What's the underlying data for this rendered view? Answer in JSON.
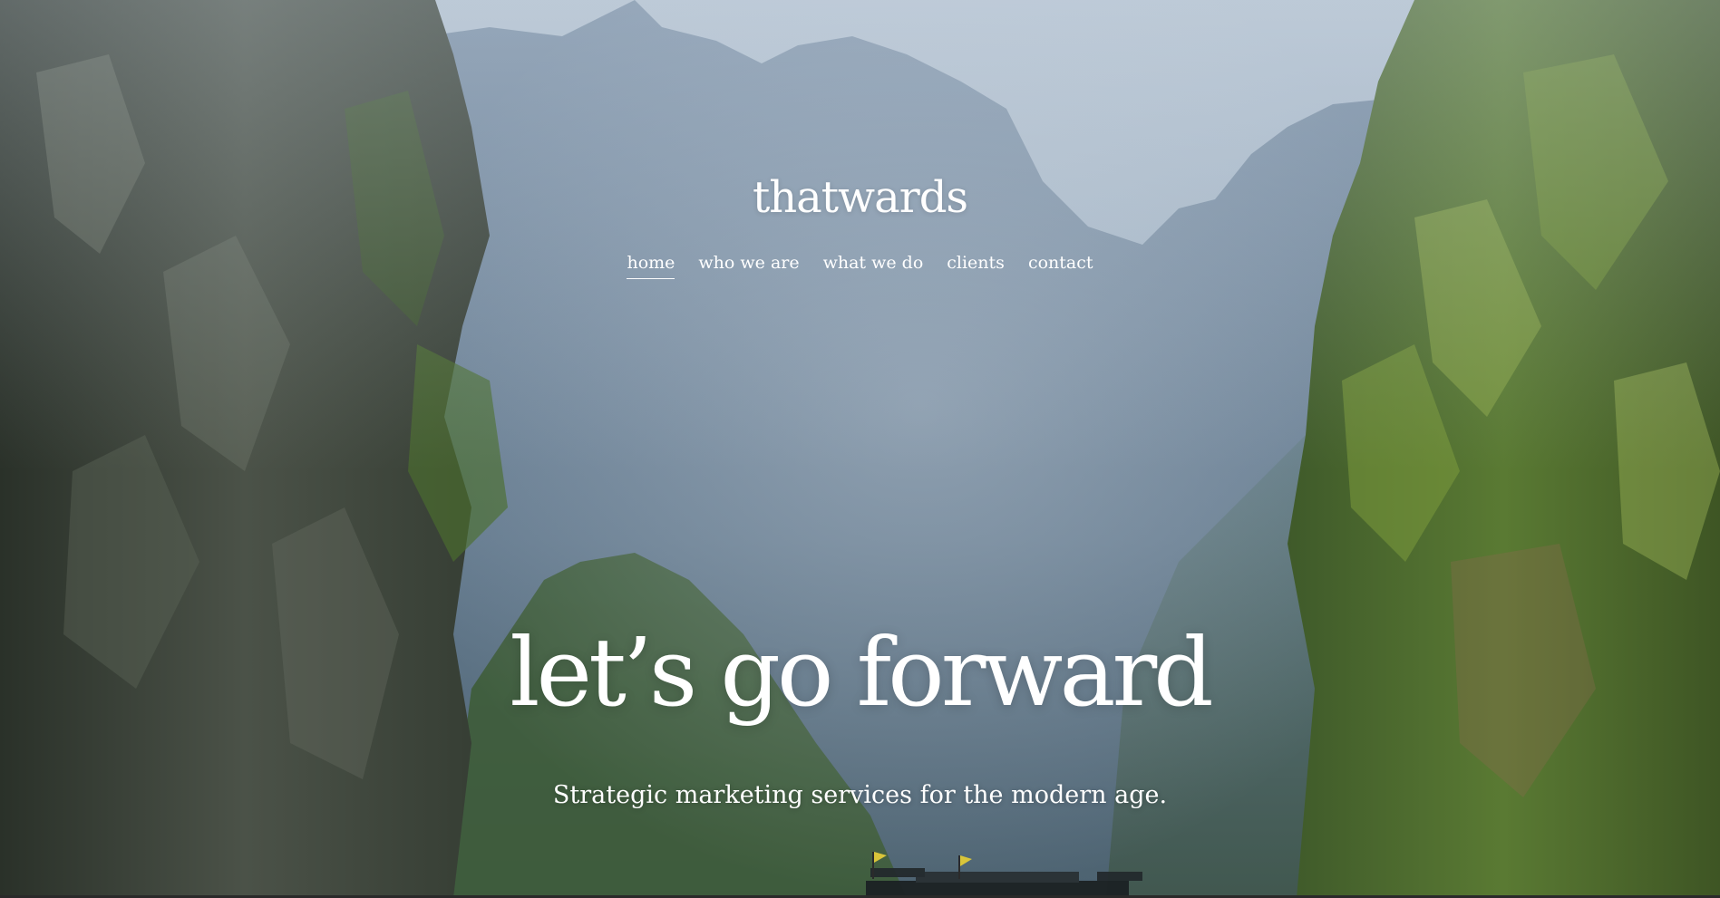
{
  "brand": {
    "name": "thatwards"
  },
  "nav": {
    "items": [
      {
        "label": "home",
        "active": true
      },
      {
        "label": "who we are",
        "active": false
      },
      {
        "label": "what we do",
        "active": false
      },
      {
        "label": "clients",
        "active": false
      },
      {
        "label": "contact",
        "active": false
      }
    ]
  },
  "hero": {
    "headline": "let’s go forward",
    "subheadline": "Strategic marketing services for the modern age."
  },
  "colors": {
    "text": "#ffffff",
    "sky": "#9fb1c4",
    "foliage": "#4f6b33"
  }
}
